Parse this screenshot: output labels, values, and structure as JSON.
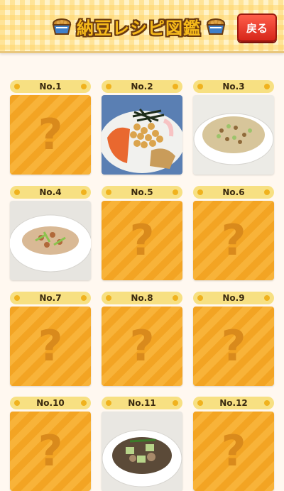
{
  "header": {
    "title": "納豆レシピ図鑑",
    "back_label": "戻る",
    "left_icon": "natto-bowl-icon",
    "right_icon": "natto-bowl-icon"
  },
  "recipes": [
    {
      "label": "No.1",
      "unlocked": false,
      "placeholder": "?"
    },
    {
      "label": "No.2",
      "unlocked": true,
      "placeholder": "?"
    },
    {
      "label": "No.3",
      "unlocked": true,
      "placeholder": "?"
    },
    {
      "label": "No.4",
      "unlocked": true,
      "placeholder": "?"
    },
    {
      "label": "No.5",
      "unlocked": false,
      "placeholder": "?"
    },
    {
      "label": "No.6",
      "unlocked": false,
      "placeholder": "?"
    },
    {
      "label": "No.7",
      "unlocked": false,
      "placeholder": "?"
    },
    {
      "label": "No.8",
      "unlocked": false,
      "placeholder": "?"
    },
    {
      "label": "No.9",
      "unlocked": false,
      "placeholder": "?"
    },
    {
      "label": "No.10",
      "unlocked": false,
      "placeholder": "?"
    },
    {
      "label": "No.11",
      "unlocked": true,
      "placeholder": "?"
    },
    {
      "label": "No.12",
      "unlocked": false,
      "placeholder": "?"
    }
  ],
  "colors": {
    "accent": "#f3a423",
    "label_bg": "#f7e082",
    "back_button": "#e63a2a"
  }
}
